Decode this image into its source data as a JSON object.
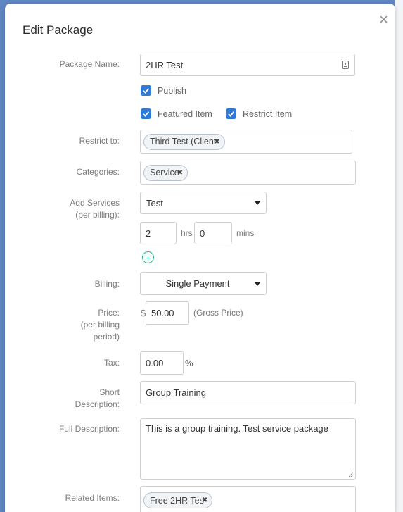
{
  "modal": {
    "title": "Edit Package",
    "close_glyph": "×"
  },
  "fields": {
    "package_name_label": "Package Name:",
    "package_name_value": "2HR Test",
    "publish_label": "Publish",
    "featured_label": "Featured Item",
    "restrict_item_label": "Restrict Item",
    "restrict_to_label": "Restrict to:",
    "restrict_to_tag": "Third Test (Client",
    "categories_label": "Categories:",
    "categories_tag": "Service",
    "add_services_label_1": "Add Services",
    "add_services_label_2": "(per billing):",
    "service_select_value": "Test",
    "hours_value": "2",
    "hours_unit": "hrs",
    "mins_value": "0",
    "mins_unit": "mins",
    "billing_label": "Billing:",
    "billing_value": "Single Payment",
    "price_label_1": "Price:",
    "price_label_2": "(per billing",
    "price_label_3": "period)",
    "currency_symbol": "$",
    "price_value": "50.00",
    "price_note": "(Gross Price)",
    "tax_label": "Tax:",
    "tax_value": "0.00",
    "tax_unit": "%",
    "short_desc_label_1": "Short",
    "short_desc_label_2": "Description:",
    "short_desc_value": "Group Training",
    "full_desc_label": "Full Description:",
    "full_desc_value": "This is a group training. Test service package",
    "related_items_label": "Related Items:",
    "related_items_tag": "Free 2HR Tes"
  },
  "checkboxes": {
    "publish_checked": true,
    "featured_checked": true,
    "restrict_item_checked": true
  },
  "colors": {
    "accent_blue": "#2f7ad6",
    "add_green": "#2fb58a",
    "backdrop": "#5f86c2"
  },
  "icons": {
    "close": "close-icon",
    "check": "checkmark-icon",
    "add": "plus-circle-icon",
    "tag_remove": "x-icon",
    "name_field": "contact-card-icon"
  }
}
